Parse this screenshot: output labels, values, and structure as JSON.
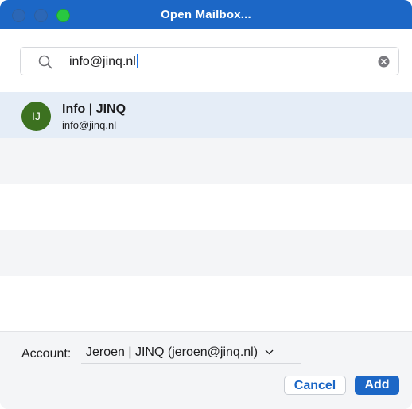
{
  "window": {
    "title": "Open Mailbox..."
  },
  "search": {
    "value": "info@jinq.nl"
  },
  "results": [
    {
      "initials": "IJ",
      "name": "Info | JINQ",
      "email": "info@jinq.nl",
      "avatar_color": "#3c7120"
    }
  ],
  "footer": {
    "account_label": "Account:",
    "account_value": "Jeroen | JINQ (jeroen@jinq.nl)",
    "cancel_label": "Cancel",
    "add_label": "Add"
  },
  "colors": {
    "accent": "#1c67c6",
    "selected_row": "#e5edf7"
  },
  "icons": {
    "search": "search-icon",
    "clear": "clear-icon",
    "dropdown": "chevron-down-icon"
  }
}
